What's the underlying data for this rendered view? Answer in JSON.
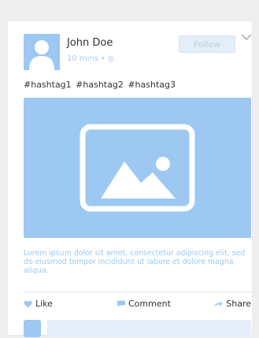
{
  "post": {
    "author": {
      "name": "John Doe",
      "time": "10 mins",
      "separator": "•",
      "avatar_icon": "user-silhouette-icon"
    },
    "follow_label": "Follow",
    "menu_icon": "chevron-down-icon",
    "hashtags": "#hashtag1  #hashtag2  #hashtag3",
    "image_icon": "image-placeholder-icon",
    "body": "Lorem ipsum dolor sit amet, consectetur adipiscing elit, sed do eiusmod tempor incididunt ut labore et dolore magna aliqua.",
    "actions": {
      "like_label": "Like",
      "like_icon": "heart-icon",
      "comment_label": "Comment",
      "comment_icon": "speech-bubble-icon",
      "share_label": "Share",
      "share_icon": "share-arrow-icon"
    },
    "comment_input": {
      "value": "",
      "placeholder": ""
    }
  },
  "colors": {
    "accent": "#9cc8f2",
    "accent_light": "#e3eef8",
    "text": "#333333",
    "background": "#eeeeee",
    "card": "#ffffff"
  }
}
